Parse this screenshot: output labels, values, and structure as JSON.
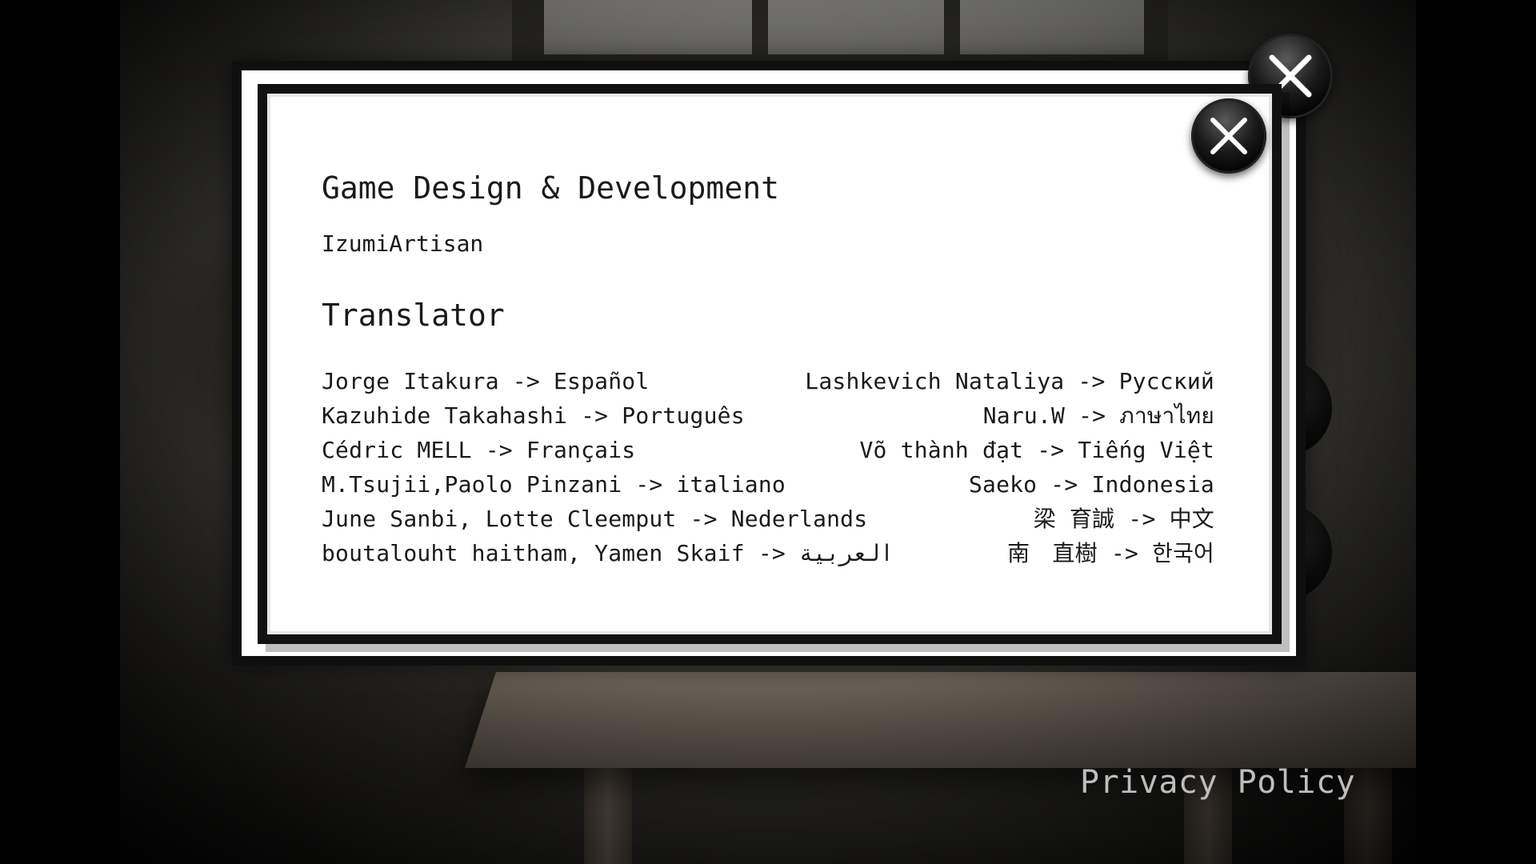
{
  "dialog": {
    "section_design_title": "Game Design & Development",
    "designer_name": "IzumiArtisan",
    "section_translator_title": "Translator",
    "translators_left": [
      "Jorge Itakura -> Español",
      "Kazuhide Takahashi -> Português",
      "Cédric MELL -> Français",
      "M.Tsujii,Paolo Pinzani -> italiano",
      "June Sanbi, Lotte Cleemput -> Nederlands",
      "boutalouht haitham, Yamen Skaif -> العربية"
    ],
    "translators_right": [
      "Lashkevich Nataliya -> Русский",
      "Naru.W -> ภาษาไทย",
      "Võ thành đạt -> Tiếng Việt",
      "Saeko -> Indonesia",
      "梁 育誠 -> 中文",
      "南　直樹 -> 한국어"
    ],
    "close_icon": "close-x-icon"
  },
  "footer": {
    "privacy_label": "Privacy Policy"
  },
  "colors": {
    "dialog_background": "#ffffff",
    "dialog_border": "#111111",
    "text": "#1a1a1a",
    "privacy_text": "#bdbdbd"
  }
}
